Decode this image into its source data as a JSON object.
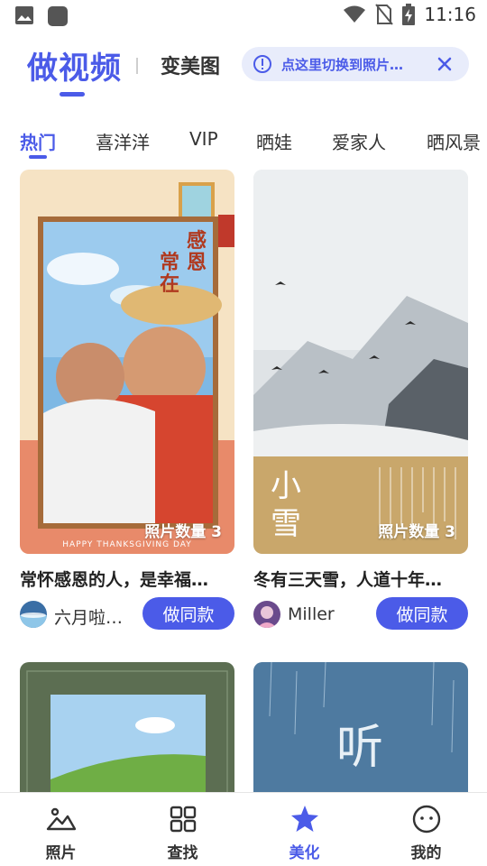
{
  "status_bar": {
    "time": "11:16",
    "icons": [
      "image-icon",
      "app-icon",
      "wifi-icon",
      "no-sim-icon",
      "battery-charging-icon"
    ]
  },
  "header": {
    "tab_make": "做视频",
    "tab_beautify": "变美图",
    "hint": "点这里切换到照片…"
  },
  "categories": [
    "热门",
    "喜洋洋",
    "VIP",
    "晒娃",
    "爱家人",
    "晒风景"
  ],
  "cards": [
    {
      "title": "常怀感恩的人，是幸福…",
      "author": "六月啦…",
      "button": "做同款",
      "photo_count": "照片数量 3",
      "overlay_title": "感恩常在",
      "overlay_sub": "HAPPY THANKSGIVING DAY"
    },
    {
      "title": "冬有三天雪，人道十年…",
      "author": "Miller",
      "button": "做同款",
      "photo_count": "照片数量 3",
      "overlay_title": "小雪"
    }
  ],
  "partial_cards": [
    {
      "overlay_title": ""
    },
    {
      "overlay_title": "听"
    }
  ],
  "bottom_nav": [
    {
      "label": "照片",
      "icon": "photo-mountain-icon"
    },
    {
      "label": "查找",
      "icon": "grid-icon"
    },
    {
      "label": "美化",
      "icon": "star-icon"
    },
    {
      "label": "我的",
      "icon": "smile-face-icon"
    }
  ],
  "colors": {
    "accent": "#4b5be8",
    "hint_bg": "#e8ecfb"
  }
}
